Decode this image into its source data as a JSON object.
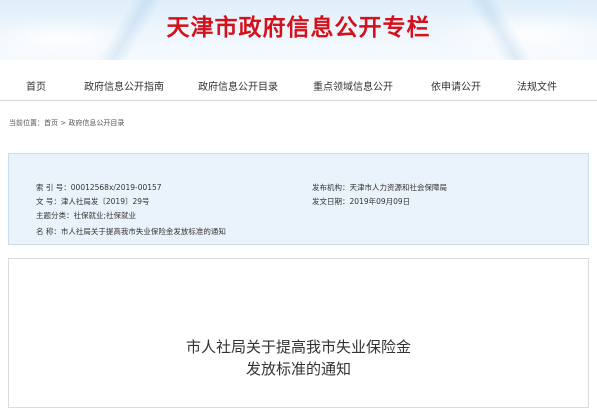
{
  "header": {
    "title": "天津市政府信息公开专栏"
  },
  "nav": {
    "items": [
      "首页",
      "政府信息公开指南",
      "政府信息公开目录",
      "重点领域信息公开",
      "依申请公开",
      "法规文件"
    ]
  },
  "breadcrumb": {
    "prefix": "当前位置：",
    "home": "首页",
    "sep": " > ",
    "current": "政府信息公开目录"
  },
  "info": {
    "index_label": "索  引  号：",
    "index_value": "00012568x/2019-00157",
    "docno_label": "文        号：",
    "docno_value": "津人社局发〔2019〕29号",
    "category_label": "主题分类：",
    "category_value": "社保就业;社保就业",
    "name_label": "名        称：",
    "name_value": "市人社局关于提高我市失业保险金发放标准的通知",
    "issuer_label": "发布机构：",
    "issuer_value": "天津市人力资源和社会保障局",
    "date_label": "发文日期：",
    "date_value": "2019年09月09日"
  },
  "document": {
    "title_line1": "市人社局关于提高我市失业保险金",
    "title_line2": "发放标准的通知"
  },
  "colors": {
    "title_red": "#d4101b",
    "info_bg": "#eaf3fb"
  }
}
